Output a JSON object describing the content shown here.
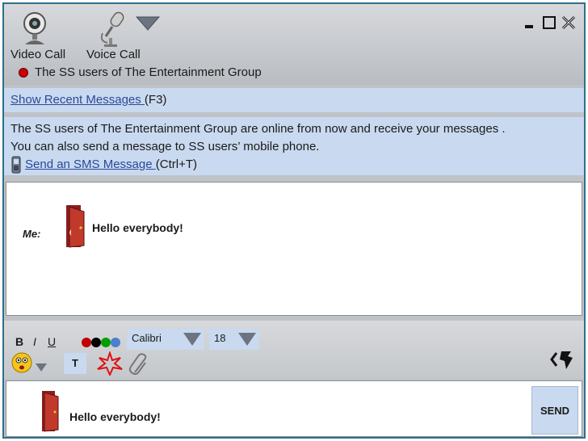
{
  "toolbar": {
    "video_call_label": "Video Call",
    "voice_call_label": "Voice Call",
    "contact_name": "The SS users of The Entertainment Group",
    "contact_status_color": "#d00000"
  },
  "recent": {
    "link_label": "Show Recent Messages ",
    "shortcut": "(F3)"
  },
  "notice": {
    "line1": "The SS users of The Entertainment Group are online from now and receive your messages .",
    "line2": "You can also send a message to SS users’ mobile phone.",
    "sms_link": "Send an SMS Message ",
    "sms_shortcut": "(Ctrl+T)"
  },
  "conversation": {
    "sender_label": "Me:",
    "message": "Hello everybody!"
  },
  "format": {
    "bold": "B",
    "italic": "I",
    "underline": "U",
    "font": "Calibri",
    "size": "18",
    "text_button": "T",
    "color_swatches": [
      "#c00000",
      "#000000",
      "#00a000",
      "#4a7fd0"
    ]
  },
  "input": {
    "text": "Hello everybody!",
    "send_label": "SEND"
  },
  "colors": {
    "panel_blue": "#c9d9ef",
    "link": "#2a4a9a",
    "border": "#2f6f8f"
  }
}
